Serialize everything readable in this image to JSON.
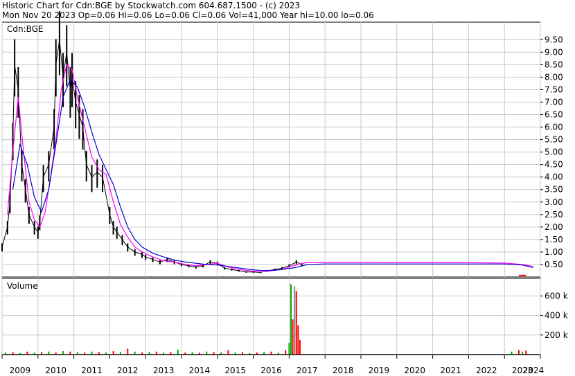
{
  "header": {
    "line1": "Historic Chart for Cdn:BGE by Stockwatch.com 604.687.1500 - (c) 2023",
    "line2": "Mon Nov 20 2023  Op=0.06  Hi=0.06  Lo=0.06  Cl=0.06  Vol=41,000  Year hi=10.00  lo=0.06"
  },
  "colors": {
    "price_bar": "#000000",
    "ma_short": "#ff00ff",
    "ma_long": "#0000cc",
    "signal": "#ff0000",
    "volume_up": "#00aa00",
    "volume_down": "#ff0000",
    "volume_flat": "#888888",
    "grid": "#c8c8c8"
  },
  "chart_data": [
    {
      "type": "line",
      "title": "Cdn:BGE",
      "xlabel": "",
      "ylabel": "",
      "x_ticks": [
        "2009",
        "2010",
        "2011",
        "2012",
        "2013",
        "2014",
        "2015",
        "2016",
        "2017",
        "2018",
        "2019",
        "2020",
        "2021",
        "2022",
        "2023",
        "2024"
      ],
      "y_ticks": [
        "9.50",
        "9.00",
        "8.50",
        "8.00",
        "7.50",
        "7.00",
        "6.50",
        "6.00",
        "5.50",
        "5.00",
        "4.50",
        "4.00",
        "3.50",
        "3.00",
        "2.50",
        "2.00",
        "1.50",
        "1.00",
        "0.50"
      ],
      "y_tick_values": [
        9.5,
        9.0,
        8.5,
        8.0,
        7.5,
        7.0,
        6.5,
        6.0,
        5.5,
        5.0,
        4.5,
        4.0,
        3.5,
        3.0,
        2.5,
        2.0,
        1.5,
        1.0,
        0.5
      ],
      "ylim": [
        0,
        10.2
      ],
      "xlim": [
        2009.0,
        2024.0
      ],
      "grid": true,
      "series": [
        {
          "name": "",
          "style": "price",
          "x": [
            2009.0,
            2009.15,
            2009.22,
            2009.3,
            2009.35,
            2009.45,
            2009.55,
            2009.65,
            2009.75,
            2009.9,
            2010.0,
            2010.05,
            2010.15,
            2010.3,
            2010.45,
            2010.5,
            2010.6,
            2010.7,
            2010.8,
            2010.9,
            2010.95,
            2011.05,
            2011.15,
            2011.25,
            2011.35,
            2011.5,
            2011.65,
            2011.8,
            2012.0,
            2012.1,
            2012.2,
            2012.35,
            2012.5,
            2012.7,
            2012.9,
            2013.0,
            2013.2,
            2013.4,
            2013.6,
            2013.8,
            2014.0,
            2014.2,
            2014.4,
            2014.6,
            2014.8,
            2015.0,
            2015.2,
            2015.4,
            2015.6,
            2015.8,
            2016.0,
            2016.2,
            2016.4,
            2016.6,
            2016.8,
            2017.0,
            2017.2,
            2017.35
          ],
          "values": [
            1.2,
            2.0,
            3.0,
            5.5,
            8.5,
            7.5,
            4.5,
            3.5,
            2.5,
            2.0,
            1.8,
            2.2,
            4.0,
            4.5,
            6.0,
            8.5,
            9.5,
            8.0,
            9.0,
            7.5,
            8.0,
            7.0,
            6.5,
            6.0,
            4.5,
            4.0,
            4.2,
            4.0,
            2.5,
            2.0,
            1.8,
            1.5,
            1.2,
            1.0,
            0.9,
            0.8,
            0.7,
            0.6,
            0.7,
            0.6,
            0.5,
            0.45,
            0.4,
            0.45,
            0.6,
            0.55,
            0.35,
            0.3,
            0.25,
            0.2,
            0.2,
            0.18,
            0.25,
            0.3,
            0.35,
            0.45,
            0.6,
            0.5
          ]
        },
        {
          "name": "",
          "style": "ma_short",
          "x": [
            2009.15,
            2009.3,
            2009.45,
            2009.6,
            2009.75,
            2009.9,
            2010.05,
            2010.2,
            2010.35,
            2010.5,
            2010.65,
            2010.8,
            2010.95,
            2011.1,
            2011.3,
            2011.5,
            2011.7,
            2011.9,
            2012.1,
            2012.3,
            2012.5,
            2012.7,
            2012.9,
            2013.2,
            2013.5,
            2013.8,
            2014.1,
            2014.4,
            2014.7,
            2015.0,
            2015.3,
            2015.6,
            2015.9,
            2016.2,
            2016.5,
            2016.8,
            2017.1,
            2017.3,
            2017.5,
            2018.0,
            2019.0,
            2020.0,
            2021.0,
            2022.0,
            2023.0,
            2023.5,
            2023.8
          ],
          "values": [
            2.5,
            5.0,
            7.2,
            5.0,
            3.0,
            2.3,
            2.0,
            2.6,
            4.0,
            5.5,
            7.5,
            8.5,
            8.3,
            7.2,
            6.0,
            4.8,
            4.3,
            4.1,
            3.0,
            2.1,
            1.6,
            1.2,
            1.0,
            0.8,
            0.65,
            0.6,
            0.5,
            0.45,
            0.5,
            0.55,
            0.4,
            0.3,
            0.25,
            0.2,
            0.25,
            0.3,
            0.45,
            0.52,
            0.58,
            0.58,
            0.58,
            0.57,
            0.57,
            0.57,
            0.56,
            0.5,
            0.42
          ]
        },
        {
          "name": "",
          "style": "ma_long",
          "x": [
            2009.3,
            2009.5,
            2009.7,
            2009.9,
            2010.1,
            2010.3,
            2010.5,
            2010.7,
            2010.9,
            2011.1,
            2011.3,
            2011.5,
            2011.7,
            2011.9,
            2012.1,
            2012.3,
            2012.5,
            2012.7,
            2012.9,
            2013.2,
            2013.5,
            2013.8,
            2014.1,
            2014.4,
            2014.7,
            2015.0,
            2015.3,
            2015.6,
            2015.9,
            2016.2,
            2016.5,
            2016.8,
            2017.1,
            2017.3,
            2017.5,
            2018.0,
            2019.0,
            2020.0,
            2021.0,
            2022.0,
            2023.0,
            2023.5,
            2023.8
          ],
          "values": [
            3.5,
            5.3,
            4.5,
            3.2,
            2.6,
            3.5,
            5.3,
            7.2,
            7.9,
            7.6,
            6.8,
            5.8,
            4.9,
            4.3,
            3.7,
            2.8,
            2.0,
            1.5,
            1.2,
            0.95,
            0.8,
            0.68,
            0.6,
            0.55,
            0.5,
            0.48,
            0.42,
            0.36,
            0.3,
            0.26,
            0.26,
            0.3,
            0.36,
            0.42,
            0.5,
            0.52,
            0.52,
            0.52,
            0.52,
            0.52,
            0.52,
            0.48,
            0.38
          ]
        },
        {
          "name": "",
          "style": "signal",
          "x": [
            2023.4,
            2023.5,
            2023.6
          ],
          "values": [
            0.06,
            0.06,
            0.06
          ]
        }
      ]
    },
    {
      "type": "bar",
      "title": "Volume",
      "xlabel": "",
      "ylabel": "",
      "y_ticks": [
        "600 k",
        "400 k",
        "200 k"
      ],
      "y_tick_values": [
        600000,
        400000,
        200000
      ],
      "ylim": [
        0,
        780000
      ],
      "grid": true,
      "series": [
        {
          "name": "",
          "x": [
            2009.1,
            2009.3,
            2009.5,
            2009.7,
            2009.9,
            2010.1,
            2010.3,
            2010.5,
            2010.7,
            2010.9,
            2011.1,
            2011.3,
            2011.5,
            2011.7,
            2011.9,
            2012.1,
            2012.3,
            2012.5,
            2012.7,
            2012.9,
            2013.1,
            2013.3,
            2013.5,
            2013.7,
            2013.9,
            2014.1,
            2014.3,
            2014.5,
            2014.7,
            2014.9,
            2015.1,
            2015.3,
            2015.5,
            2015.7,
            2015.9,
            2016.1,
            2016.3,
            2016.5,
            2016.7,
            2016.9,
            2017.0,
            2017.05,
            2017.1,
            2017.15,
            2017.2,
            2017.25,
            2017.3,
            2023.2,
            2023.4,
            2023.5,
            2023.6
          ],
          "values": [
            20000,
            25000,
            15000,
            30000,
            20000,
            25000,
            30000,
            20000,
            35000,
            30000,
            25000,
            20000,
            30000,
            25000,
            20000,
            35000,
            25000,
            60000,
            30000,
            20000,
            25000,
            30000,
            20000,
            25000,
            50000,
            20000,
            25000,
            20000,
            30000,
            25000,
            20000,
            45000,
            20000,
            25000,
            15000,
            20000,
            25000,
            30000,
            20000,
            45000,
            120000,
            720000,
            360000,
            700000,
            650000,
            300000,
            150000,
            30000,
            45000,
            25000,
            41000
          ],
          "colors": [
            "g",
            "r",
            "g",
            "r",
            "g",
            "r",
            "g",
            "r",
            "g",
            "r",
            "g",
            "r",
            "g",
            "r",
            "g",
            "r",
            "g",
            "r",
            "g",
            "r",
            "g",
            "r",
            "g",
            "r",
            "g",
            "r",
            "g",
            "r",
            "g",
            "r",
            "g",
            "r",
            "g",
            "r",
            "g",
            "r",
            "g",
            "r",
            "g",
            "r",
            "g",
            "g",
            "r",
            "k",
            "r",
            "r",
            "r",
            "g",
            "r",
            "g",
            "r"
          ]
        }
      ]
    }
  ]
}
